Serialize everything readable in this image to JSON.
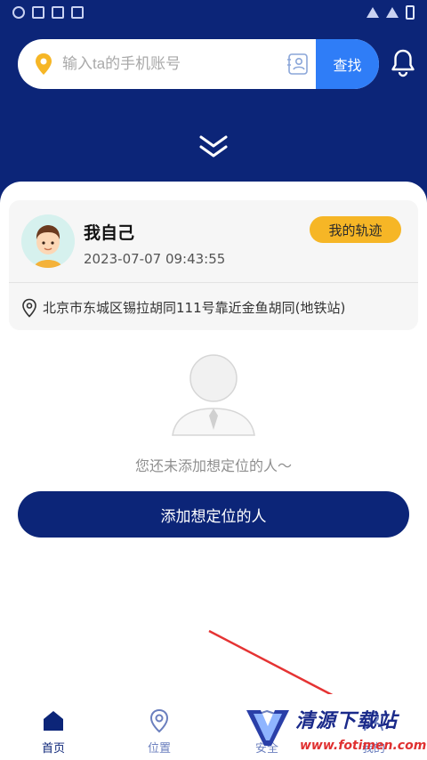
{
  "search": {
    "placeholder": "输入ta的手机账号",
    "button_label": "查找"
  },
  "me": {
    "name": "我自己",
    "timestamp": "2023-07-07 09:43:55",
    "track_button": "我的轨迹",
    "address": "北京市东城区锡拉胡同111号靠近金鱼胡同(地铁站)"
  },
  "empty_state": {
    "message": "您还未添加想定位的人～",
    "add_button": "添加想定位的人"
  },
  "tabs": [
    {
      "label": "首页",
      "icon": "home-icon",
      "active": true
    },
    {
      "label": "位置",
      "icon": "location-icon",
      "active": false
    },
    {
      "label": "安全",
      "icon": "shield-icon",
      "active": false
    },
    {
      "label": "我的",
      "icon": "user-icon",
      "active": false
    }
  ],
  "watermark": {
    "title": "清源下载站",
    "url": "www.fotimen.com"
  },
  "colors": {
    "primary": "#0c2578",
    "accent_blue": "#2f7df7",
    "badge_yellow": "#f6b626"
  }
}
